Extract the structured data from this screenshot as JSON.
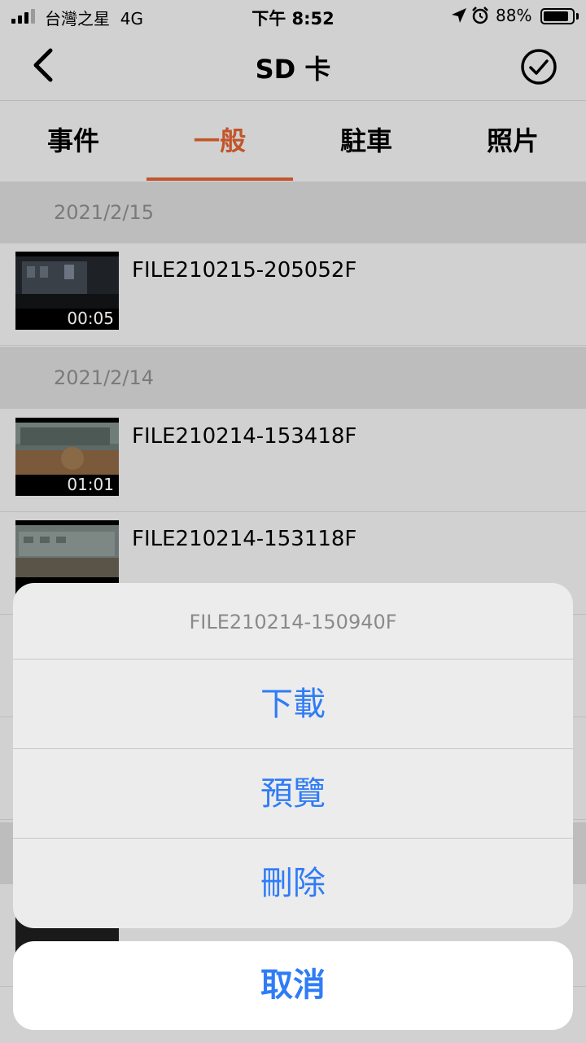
{
  "status_bar": {
    "carrier": "台灣之星",
    "network": "4G",
    "time": "下午 8:52",
    "battery_percent": "88%",
    "battery_level": 0.88,
    "signal_bars": 3
  },
  "nav": {
    "title": "SD 卡",
    "back_icon": "chevron-left-icon",
    "select_icon": "checkmark-circle-icon"
  },
  "tabs": [
    {
      "label": "事件",
      "active": false
    },
    {
      "label": "一般",
      "active": true
    },
    {
      "label": "駐車",
      "active": false
    },
    {
      "label": "照片",
      "active": false
    }
  ],
  "sections": [
    {
      "date": "2021/2/15",
      "files": [
        {
          "name": "FILE210215-205052F",
          "duration": "00:05"
        }
      ]
    },
    {
      "date": "2021/2/14",
      "files": [
        {
          "name": "FILE210214-153418F",
          "duration": "01:01"
        },
        {
          "name": "FILE210214-153118F",
          "duration": ""
        }
      ]
    }
  ],
  "action_sheet": {
    "title": "FILE210214-150940F",
    "actions": [
      "下載",
      "預覽",
      "刪除"
    ],
    "cancel": "取消"
  },
  "colors": {
    "accent": "#c2552a",
    "action_blue": "#2f7cf6"
  }
}
